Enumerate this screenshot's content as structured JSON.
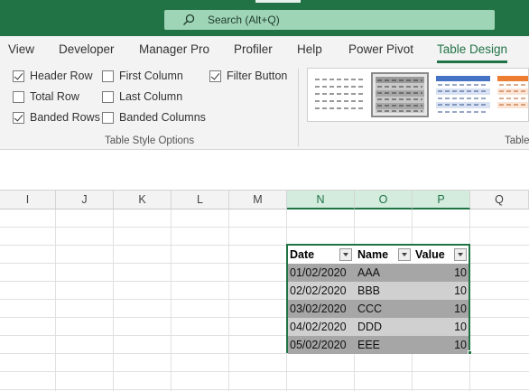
{
  "search": {
    "text": "Search (Alt+Q)"
  },
  "tabs": [
    {
      "label": "View"
    },
    {
      "label": "Developer"
    },
    {
      "label": "Manager Pro"
    },
    {
      "label": "Profiler"
    },
    {
      "label": "Help"
    },
    {
      "label": "Power Pivot"
    },
    {
      "label": "Table Design",
      "active": true
    }
  ],
  "table_style_options": {
    "group_label": "Table Style Options",
    "options": [
      {
        "label": "Header Row",
        "checked": true
      },
      {
        "label": "Total Row",
        "checked": false
      },
      {
        "label": "Banded Rows",
        "checked": true
      },
      {
        "label": "First Column",
        "checked": false
      },
      {
        "label": "Last Column",
        "checked": false
      },
      {
        "label": "Banded Columns",
        "checked": false
      },
      {
        "label": "Filter Button",
        "checked": true
      }
    ]
  },
  "table_styles": {
    "group_label": "Table"
  },
  "columns": [
    "I",
    "J",
    "K",
    "L",
    "M",
    "N",
    "O",
    "P",
    "Q"
  ],
  "table": {
    "headers": [
      "Date",
      "Name",
      "Value"
    ],
    "rows": [
      [
        "01/02/2020",
        "AAA",
        "10"
      ],
      [
        "02/02/2020",
        "BBB",
        "10"
      ],
      [
        "03/02/2020",
        "CCC",
        "10"
      ],
      [
        "04/02/2020",
        "DDD",
        "10"
      ],
      [
        "05/02/2020",
        "EEE",
        "10"
      ]
    ]
  },
  "colors": {
    "accent": "#217346",
    "search_bg": "#9fd5b7",
    "band_dark": "#a6a6a6",
    "band_light": "#d0d0d0"
  }
}
